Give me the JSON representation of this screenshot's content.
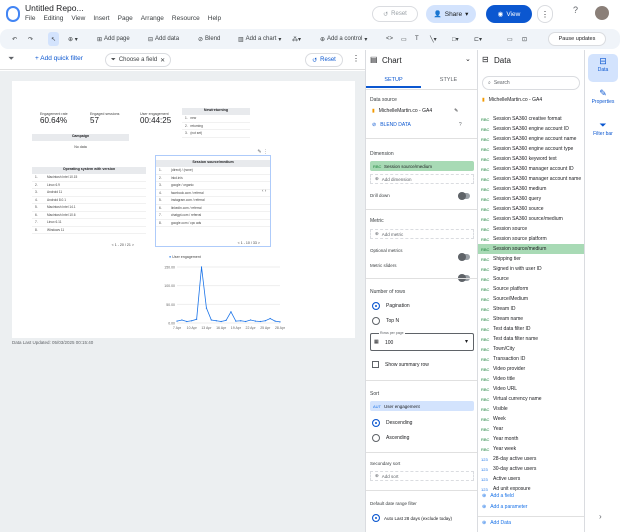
{
  "app": {
    "title": "Untitled Repo...",
    "menus": [
      "File",
      "Editing",
      "View",
      "Insert",
      "Page",
      "Arrange",
      "Resource",
      "Help"
    ]
  },
  "header": {
    "reset_label": "Reset",
    "share_label": "Share",
    "view_label": "View",
    "kebab": "⋮",
    "help": "?"
  },
  "toolbar": {
    "undo": "↶",
    "redo": "↷",
    "add_page": "Add page",
    "add_data": "Add data",
    "blend": "Blend",
    "add_chart": "Add a chart",
    "add_control": "Add a control",
    "pause_updates": "Pause updates"
  },
  "filterbar": {
    "add_quick_filter": "+ Add quick filter",
    "choose_field": "Choose a field",
    "reset": "Reset"
  },
  "report": {
    "kpis": [
      {
        "label": "Engagement rate",
        "value": "60.64%"
      },
      {
        "label": "Engaged sessions",
        "value": "57"
      },
      {
        "label": "User engagement",
        "value": "00:44:25"
      }
    ],
    "newret": {
      "header": "New/returning",
      "rows": [
        "1.",
        "new",
        "2.",
        "returning",
        "3.",
        "(not set)"
      ]
    },
    "campaign": {
      "header": "Campaign",
      "empty": "No data"
    },
    "os": {
      "header": "Operating system with version",
      "rows": [
        "Macintosh Intel 10.15",
        "Linux 6.9",
        "Android 11",
        "Android 8.0.1",
        "Macintosh Intel 14.1",
        "Macintosh Intel 10.6",
        "Linux 6.11",
        "Windows 11"
      ],
      "pager": "1 - 20 / 21"
    },
    "ssm": {
      "header": "Session source/medium",
      "rows": [
        "(direct) / (none)",
        "lnkd.in/s",
        "google / organic",
        "facebook.com / referral",
        "instagram.com / referral",
        "linkedin.com / referral",
        "chatgpt.com / referral",
        "google.com / cpc ads"
      ],
      "pager": "1 - 10 / 33"
    },
    "line": {
      "legend": "User engagement",
      "yticks": [
        "150.00",
        "100.00",
        "50.00",
        "0.00"
      ],
      "xticks": [
        "7 Apr",
        "10 Apr",
        "13 Apr",
        "16 Apr",
        "19 Apr",
        "22 Apr",
        "25 Apr",
        "28 Apr"
      ]
    },
    "last_updated": "Data Last Updated: 05/03/2025 00:15:40"
  },
  "chart_data": {
    "type": "line",
    "series": [
      {
        "name": "User engagement",
        "values": [
          5,
          8,
          4,
          6,
          10,
          150,
          40,
          8,
          6,
          4,
          7,
          30,
          5,
          6,
          4,
          8,
          5,
          4,
          6,
          12,
          5,
          3
        ]
      }
    ],
    "ylim": [
      0,
      150
    ]
  },
  "chart_panel": {
    "title": "Chart",
    "tabs": [
      "SETUP",
      "STYLE"
    ],
    "data_source_label": "Data source",
    "data_source": "MichelleMartin.co - GA4",
    "blend_data": "BLEND DATA",
    "dimension_label": "Dimension",
    "dimension": "Session source/medium",
    "add_dimension": "Add dimension",
    "drill_down": "Drill down",
    "metric_label": "Metric",
    "add_metric": "Add metric",
    "optional_metrics": "Optional metrics",
    "metric_sliders": "Metric sliders",
    "rows_label": "Number of rows",
    "pagination": "Pagination",
    "top_n": "Top N",
    "rows_per_page_label": "Rows per page",
    "rows_per_page": "100",
    "show_summary": "Show summary row",
    "sort_label": "Sort",
    "sort_field": "User engagement",
    "descending": "Descending",
    "ascending": "Ascending",
    "secondary_sort": "Secondary sort",
    "add_sort": "Add sort",
    "date_range_label": "Default date range filter",
    "date_range": "Auto  Last 28 days (exclude today)"
  },
  "data_panel": {
    "title": "Data",
    "search_placeholder": "Search",
    "source": "MichelleMartin.co - GA4",
    "fields": [
      "Session SA360 creative format",
      "Session SA360 engine account ID",
      "Session SA360 engine account name",
      "Session SA360 engine account type",
      "Session SA360 keyword text",
      "Session SA360 manager account ID",
      "Session SA360 manager account name",
      "Session SA360 medium",
      "Session SA360 query",
      "Session SA360 source",
      "Session SA360 source/medium",
      "Session source",
      "Session source platform",
      "Session source/medium",
      "Shipping tier",
      "Signed in with user ID",
      "Source",
      "Source platform",
      "Source/Medium",
      "Stream ID",
      "Stream name",
      "Test data filter ID",
      "Test data filter name",
      "Town/City",
      "Transaction ID",
      "Video provider",
      "Video title",
      "Video URL",
      "Virtual currency name",
      "Visible",
      "Week",
      "Year",
      "Year month",
      "Year week",
      "28-day active users",
      "30-day active users",
      "Active users",
      "Ad unit exposure"
    ],
    "add_field": "Add a field",
    "add_parameter": "Add a parameter",
    "add_data": "Add Data"
  },
  "rail": {
    "data": "Data",
    "properties": "Properties",
    "filter_bar": "Filter bar"
  },
  "colors": {
    "accent": "#0b57d0",
    "share_bg": "#d3e3fd",
    "selected_field": "#a8dab5"
  }
}
